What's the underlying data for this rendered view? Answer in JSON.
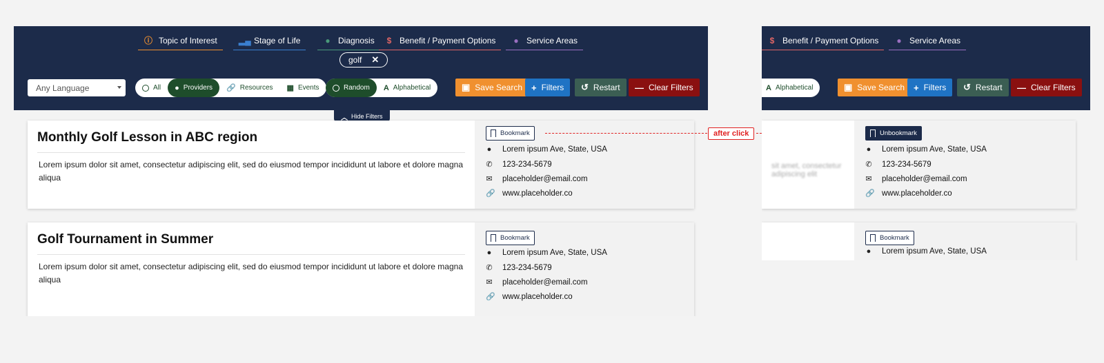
{
  "colors": {
    "navbar": "#1c2b4a",
    "provider_green": "#1e4d2b",
    "save": "#f0902f",
    "filters": "#1f73c4",
    "restart": "#3b5e53",
    "clear": "#8a1010",
    "annotation": "#e02020"
  },
  "topics": [
    {
      "label": "Topic of Interest",
      "icon": "info-icon",
      "color": "#f0902f"
    },
    {
      "label": "Stage of Life",
      "icon": "bar-chart-icon",
      "color": "#3a7fd0"
    },
    {
      "label": "Diagnosis",
      "icon": "person-icon",
      "color": "#4a9a7a"
    },
    {
      "label": "Benefit / Payment Options",
      "icon": "dollar-icon",
      "color": "#e06666"
    },
    {
      "label": "Service Areas",
      "icon": "map-pin-icon",
      "color": "#9a6fc0"
    }
  ],
  "search_chip": {
    "label": "golf"
  },
  "language_select": {
    "value": "Any Language"
  },
  "type_filter": {
    "all": "All",
    "providers": "Providers",
    "resources": "Resources",
    "events": "Events"
  },
  "sort_filter": {
    "random": "Random",
    "alphabetical": "Alphabetical"
  },
  "actions": {
    "save": "Save Search",
    "filters": "Filters",
    "restart": "Restart",
    "clear": "Clear Filters"
  },
  "hide_filters": "Hide Filters",
  "cards": [
    {
      "title": "Monthly Golf Lesson in ABC region",
      "description": "Lorem ipsum dolor sit amet, consectetur adipiscing elit, sed do eiusmod tempor incididunt ut labore et dolore magna aliqua",
      "bookmark": "Bookmark",
      "address": "Lorem ipsum Ave, State, USA",
      "phone": "123-234-5679",
      "email": "placeholder@email.com",
      "website": "www.placeholder.co"
    },
    {
      "title": "Golf Tournament in Summer",
      "description": "Lorem ipsum dolor sit amet, consectetur adipiscing elit, sed do eiusmod tempor incididunt ut labore et dolore magna aliqua",
      "bookmark": "Bookmark",
      "address": "Lorem ipsum Ave, State, USA",
      "phone": "123-234-5679",
      "email": "placeholder@email.com",
      "website": "www.placeholder.co"
    }
  ],
  "annotation": {
    "label": "after click"
  },
  "after_state": {
    "unbookmark": "Unbookmark",
    "bookmark": "Bookmark",
    "blurred_desc": "sit amet, consectetur adipiscing elit"
  }
}
